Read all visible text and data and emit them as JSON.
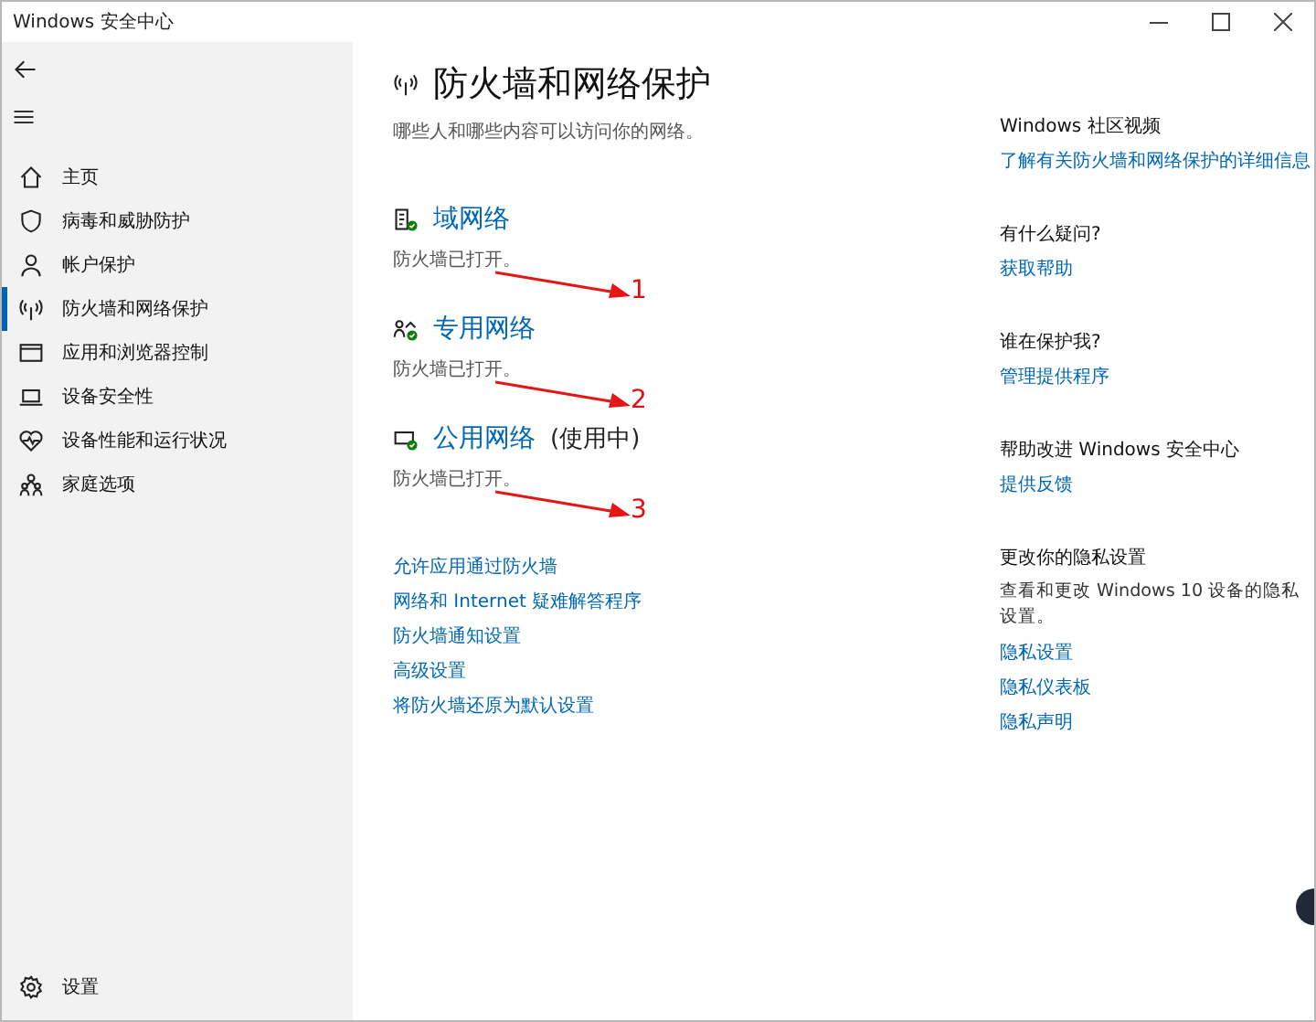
{
  "window": {
    "title": "Windows 安全中心"
  },
  "sidebar": {
    "items": [
      {
        "kind": "home",
        "label": "主页",
        "selected": false
      },
      {
        "kind": "shield",
        "label": "病毒和威胁防护",
        "selected": false
      },
      {
        "kind": "person",
        "label": "帐户保护",
        "selected": false
      },
      {
        "kind": "antenna",
        "label": "防火墙和网络保护",
        "selected": true
      },
      {
        "kind": "browser",
        "label": "应用和浏览器控制",
        "selected": false
      },
      {
        "kind": "laptop",
        "label": "设备安全性",
        "selected": false
      },
      {
        "kind": "heart",
        "label": "设备性能和运行状况",
        "selected": false
      },
      {
        "kind": "family",
        "label": "家庭选项",
        "selected": false
      }
    ],
    "settings": "设置"
  },
  "page": {
    "title": "防火墙和网络保护",
    "subtitle": "哪些人和哪些内容可以访问你的网络。",
    "networks": [
      {
        "kind": "domain",
        "name": "域网络",
        "status": "防火墙已打开。",
        "annotation": "1"
      },
      {
        "kind": "private",
        "name": "专用网络",
        "status": "防火墙已打开。",
        "annotation": "2"
      },
      {
        "kind": "public",
        "name": "公用网络",
        "suffix": "(使用中)",
        "status": "防火墙已打开。",
        "annotation": "3"
      }
    ],
    "links": [
      "允许应用通过防火墙",
      "网络和 Internet 疑难解答程序",
      "防火墙通知设置",
      "高级设置",
      "将防火墙还原为默认设置"
    ]
  },
  "aside": [
    {
      "heading": "Windows 社区视频",
      "links": [
        "了解有关防火墙和网络保护的详细信息"
      ]
    },
    {
      "heading": "有什么疑问?",
      "links": [
        "获取帮助"
      ]
    },
    {
      "heading": "谁在保护我?",
      "links": [
        "管理提供程序"
      ]
    },
    {
      "heading": "帮助改进 Windows 安全中心",
      "links": [
        "提供反馈"
      ]
    },
    {
      "heading": "更改你的隐私设置",
      "text": "查看和更改 Windows 10 设备的隐私设置。",
      "links": [
        "隐私设置",
        "隐私仪表板",
        "隐私声明"
      ]
    }
  ]
}
